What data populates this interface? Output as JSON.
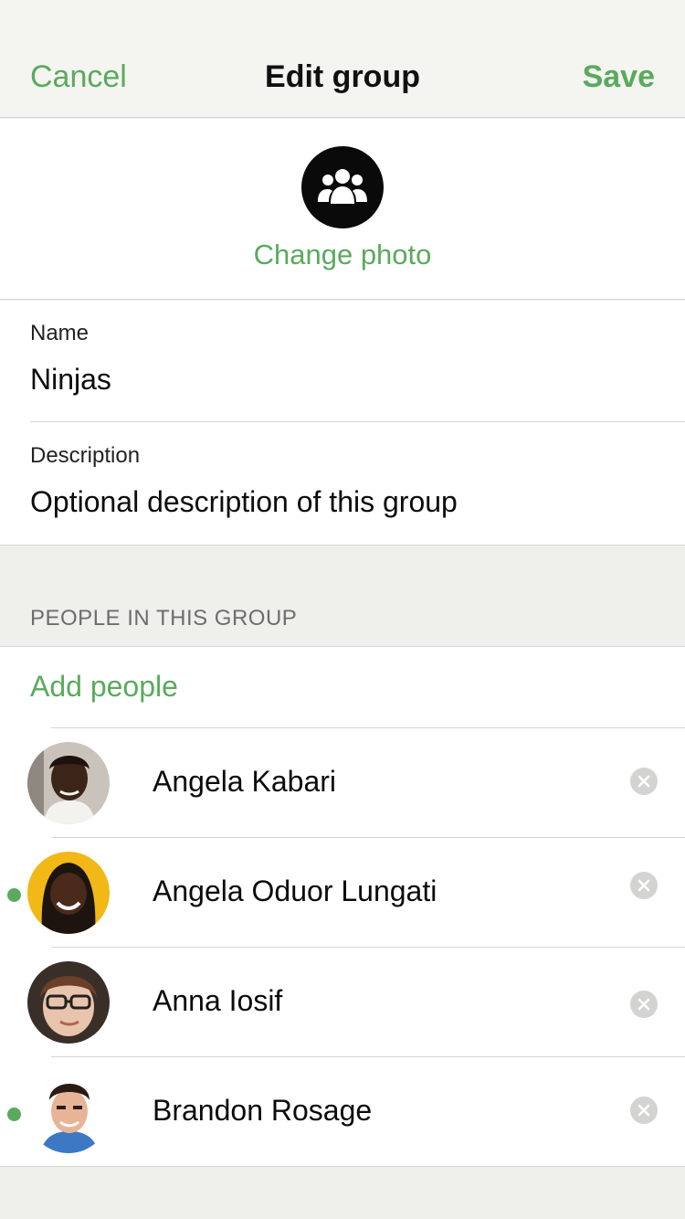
{
  "navbar": {
    "cancel_label": "Cancel",
    "title": "Edit group",
    "save_label": "Save"
  },
  "photo": {
    "icon": "group-icon",
    "change_label": "Change photo"
  },
  "form": {
    "name_label": "Name",
    "name_value": "Ninjas",
    "description_label": "Description",
    "description_value": "Optional description of this group"
  },
  "people": {
    "header": "PEOPLE IN THIS GROUP",
    "add_label": "Add people",
    "members": [
      {
        "name": "Angela Kabari",
        "online": false
      },
      {
        "name": "Angela Oduor Lungati",
        "online": true
      },
      {
        "name": "Anna Iosif",
        "online": false
      },
      {
        "name": "Brandon Rosage",
        "online": true
      }
    ]
  },
  "colors": {
    "accent": "#5aaa5d",
    "background": "#efefec",
    "divider": "#d6d6d3"
  }
}
